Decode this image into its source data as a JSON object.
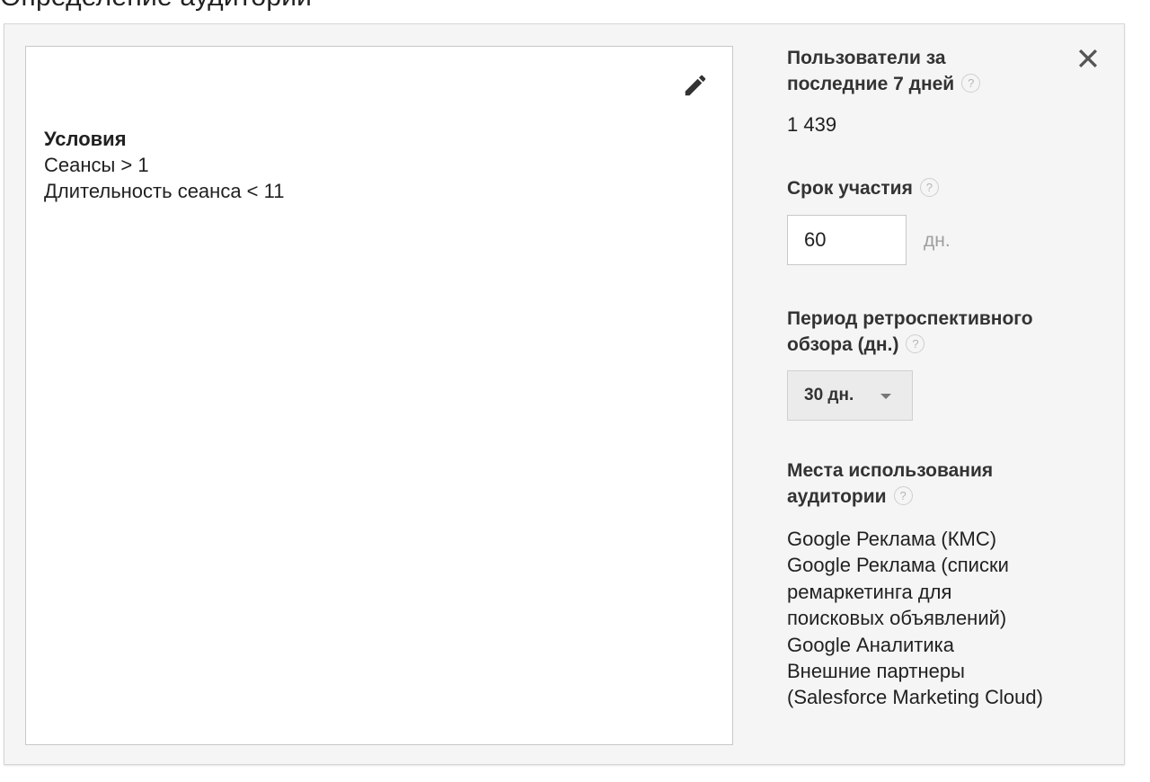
{
  "page": {
    "heading": "Определение аудитории"
  },
  "conditions": {
    "title": "Условия",
    "items": [
      "Сеансы > 1",
      "Длительность сеанса < 11"
    ]
  },
  "icons": {
    "edit": "pencil-icon",
    "close": "close-icon",
    "help": "help-icon",
    "dropdown": "caret-down-icon"
  },
  "sidebar": {
    "users_label_line1": "Пользователи за",
    "users_label_line2": "последние 7 дней",
    "users_value": "1 439",
    "duration_label": "Срок участия",
    "duration_value": "60",
    "duration_unit": "дн.",
    "lookback_label_line1": "Период ретроспективного",
    "lookback_label_line2": "обзора (дн.)",
    "lookback_selected": "30 дн.",
    "usage_label_line1": "Места использования",
    "usage_label_line2": "аудитории",
    "usage_items": [
      "Google Реклама (КМС)",
      "Google Реклама (списки",
      "ремаркетинга для",
      "поисковых объявлений)",
      "Google Аналитика",
      "Внешние партнеры",
      "(Salesforce Marketing Cloud)"
    ],
    "help_glyph": "?"
  }
}
